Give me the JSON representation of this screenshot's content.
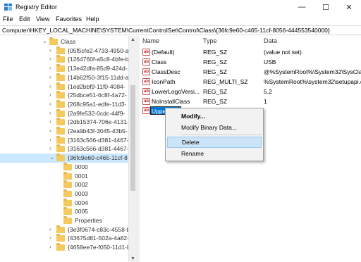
{
  "window": {
    "title": "Registry Editor",
    "minimize_glyph": "—",
    "maximize_glyph": "☐",
    "close_glyph": "✕"
  },
  "menubar": [
    "File",
    "Edit",
    "View",
    "Favorites",
    "Help"
  ],
  "address": "Computer\\HKEY_LOCAL_MACHINE\\SYSTEM\\CurrentControlSet\\Control\\Class\\{36fc9e60-c465-11cf-8056-444553540000}",
  "tree": {
    "items": [
      {
        "label": "Class",
        "expanded": true
      },
      {
        "label": "{05f5cfe2-4733-4950-a",
        "expanded": false
      },
      {
        "label": "{1264760f-a5c8-4bfe-b",
        "expanded": false
      },
      {
        "label": "{13e42dfa-85d9-424d-",
        "expanded": false
      },
      {
        "label": "{14b62f50-3f15-11dd-a",
        "expanded": false
      },
      {
        "label": "{1ed2bbf9-11f0-4084-",
        "expanded": false
      },
      {
        "label": "{25dbce51-6c8f-4a72-",
        "expanded": false
      },
      {
        "label": "{268c95a1-edfe-11d3-",
        "expanded": false
      },
      {
        "label": "{2a9fe532-0cdc-44f9-",
        "expanded": false
      },
      {
        "label": "{2db15374-706e-4131-",
        "expanded": false
      },
      {
        "label": "{2ea9b43f-3045-43b5-",
        "expanded": false
      },
      {
        "label": "{3163c566-d381-4467-",
        "expanded": false
      },
      {
        "label": "{3163c566-d381-4467-",
        "expanded": false
      },
      {
        "label": "{36fc9e60-c465-11cf-8",
        "expanded": true,
        "selected": true
      },
      {
        "label": "0000",
        "child": true
      },
      {
        "label": "0001",
        "child": true
      },
      {
        "label": "0002",
        "child": true
      },
      {
        "label": "0003",
        "child": true
      },
      {
        "label": "0004",
        "child": true
      },
      {
        "label": "0005",
        "child": true
      },
      {
        "label": "Properties",
        "child": true
      },
      {
        "label": "{3e3f0674-c83c-4558-b",
        "expanded": false
      },
      {
        "label": "{43675d81-502a-4a82-",
        "expanded": false
      },
      {
        "label": "{4658ee7e-f050-11d1-b",
        "expanded": false
      }
    ]
  },
  "values": {
    "columns": [
      "Name",
      "Type",
      "Data"
    ],
    "rows": [
      {
        "name": "(Default)",
        "type": "REG_SZ",
        "data": "(value not set)"
      },
      {
        "name": "Class",
        "type": "REG_SZ",
        "data": "USB"
      },
      {
        "name": "ClassDesc",
        "type": "REG_SZ",
        "data": "@%SystemRoot%\\System32\\SysCla"
      },
      {
        "name": "IconPath",
        "type": "REG_MULTI_SZ",
        "data": "%SystemRoot%\\system32\\setupapi.d"
      },
      {
        "name": "LowerLogoVersi...",
        "type": "REG_SZ",
        "data": "5.2"
      },
      {
        "name": "NoInstallClass",
        "type": "REG_SZ",
        "data": "1"
      },
      {
        "name": "UpperFilt",
        "type": "REG_SZ",
        "data": "",
        "editing": true
      }
    ],
    "value_icon_text": "ab"
  },
  "context_menu": {
    "items": [
      "Modify...",
      "Modify Binary Data...",
      "Delete",
      "Rename"
    ]
  },
  "colors": {
    "selection": "#cce8ff",
    "edit_highlight": "#0078d7",
    "menu_hover": "#cce4f7",
    "folder": "#f4c95d"
  }
}
